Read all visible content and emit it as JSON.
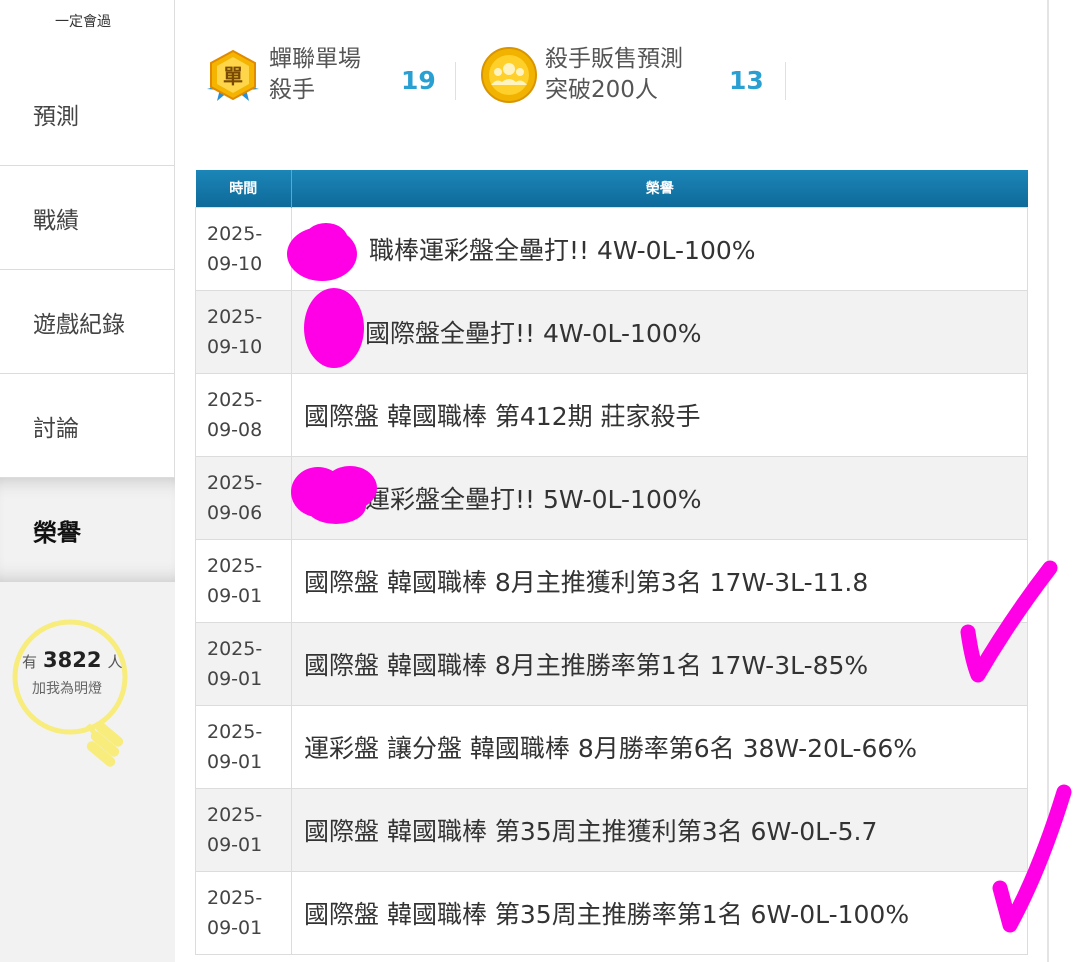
{
  "sidebar": {
    "top_label": "一定會過",
    "items": [
      {
        "label": "預測"
      },
      {
        "label": "戰績"
      },
      {
        "label": "遊戲紀錄"
      },
      {
        "label": "討論"
      },
      {
        "label": "榮譽"
      }
    ],
    "active": "榮譽",
    "lamp": {
      "prefix": "有",
      "count": "3822",
      "suffix": "人",
      "caption": "加我為明燈"
    }
  },
  "stats": [
    {
      "icon": "single-badge-icon",
      "line1": "蟬聯單場",
      "line2": "殺手",
      "count": "19"
    },
    {
      "icon": "crowd-medal-icon",
      "line1": "殺手販售預測",
      "line2": "突破200人",
      "count": "13"
    }
  ],
  "table": {
    "headers": {
      "date": "時間",
      "title": "榮譽"
    },
    "rows": [
      {
        "date": "2025-09-10",
        "title": "職棒運彩盤全壘打!! 4W-0L-100%"
      },
      {
        "date": "2025-09-10",
        "title": "國際盤全壘打!! 4W-0L-100%"
      },
      {
        "date": "2025-09-08",
        "title": "國際盤 韓國職棒 第412期 莊家殺手"
      },
      {
        "date": "2025-09-06",
        "title": "運彩盤全壘打!! 5W-0L-100%"
      },
      {
        "date": "2025-09-01",
        "title": "國際盤 韓國職棒 8月主推獲利第3名 17W-3L-11.8"
      },
      {
        "date": "2025-09-01",
        "title": "國際盤 韓國職棒 8月主推勝率第1名 17W-3L-85%"
      },
      {
        "date": "2025-09-01",
        "title": "運彩盤 讓分盤 韓國職棒 8月勝率第6名 38W-20L-66%"
      },
      {
        "date": "2025-09-01",
        "title": "國際盤 韓國職棒 第35周主推獲利第3名 6W-0L-5.7"
      },
      {
        "date": "2025-09-01",
        "title": "國際盤 韓國職棒 第35周主推勝率第1名 6W-0L-100%"
      }
    ]
  },
  "colors": {
    "header_blue": "#1c86b8",
    "count_blue": "#2aa0d2",
    "annotation_magenta": "#ff00e6",
    "lamp_yellow": "#f7ec7c"
  }
}
